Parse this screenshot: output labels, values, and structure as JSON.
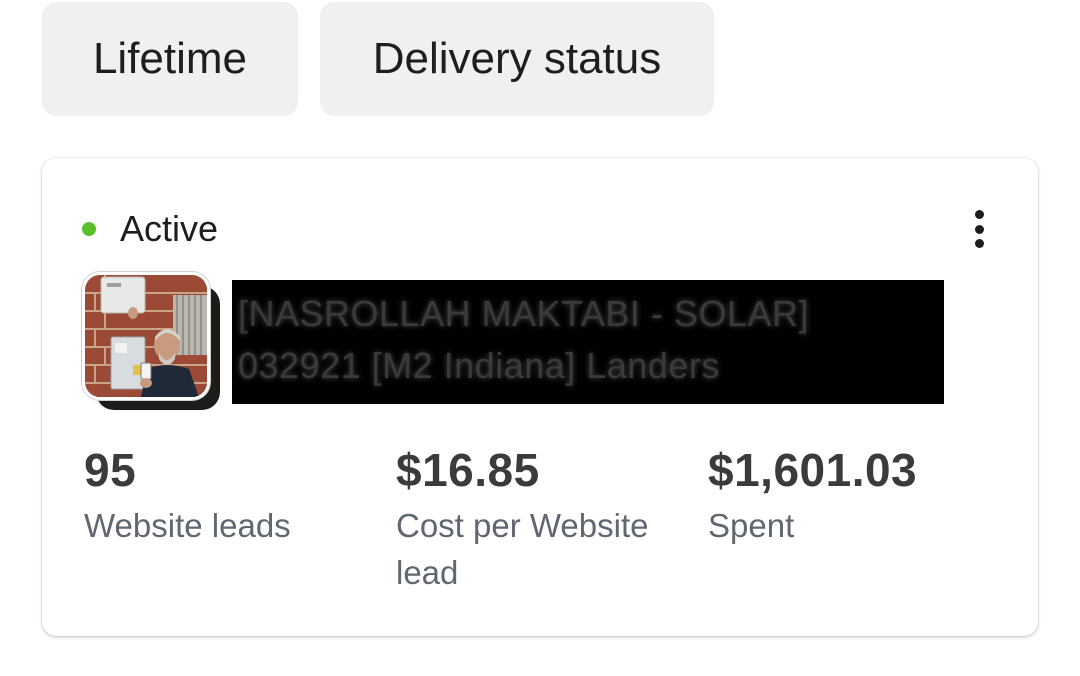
{
  "filters": {
    "lifetime_label": "Lifetime",
    "delivery_status_label": "Delivery status"
  },
  "ad_card": {
    "status": "Active",
    "status_color": "#5bbf2a",
    "more_icon": "more-vertical-icon",
    "thumbnail_icon": "ad-thumbnail-image",
    "name_redacted": true,
    "name_lines": [
      "[NASROLLAH MAKTABI - SOLAR]",
      "032921 [M2 Indiana] Landers"
    ],
    "metrics": [
      {
        "value": "95",
        "label": "Website leads"
      },
      {
        "value": "$16.85",
        "label": "Cost per Website lead"
      },
      {
        "value": "$1,601.03",
        "label": "Spent"
      }
    ]
  }
}
